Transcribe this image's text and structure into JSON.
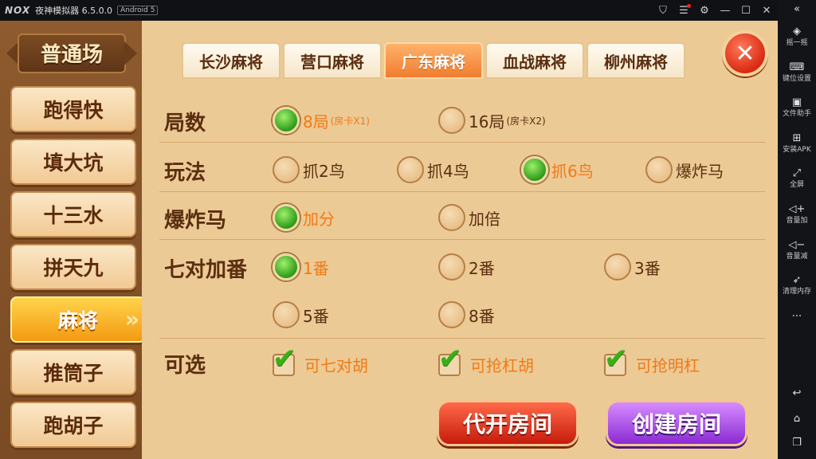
{
  "emulator": {
    "logo": "NOX",
    "app_name": "夜神模拟器 6.5.0.0",
    "android_badge": "Android 5",
    "controls": [
      "shirt-icon",
      "menu-icon",
      "gear-icon",
      "minimize-icon",
      "maximize-icon",
      "close-icon"
    ],
    "sidebar": [
      {
        "icon": "collapse-icon",
        "label": ""
      },
      {
        "icon": "shake-icon",
        "label": "摇一摇"
      },
      {
        "icon": "keyboard-icon",
        "label": "键位设置"
      },
      {
        "icon": "file-helper-icon",
        "label": "文件助手"
      },
      {
        "icon": "install-apk-icon",
        "label": "安装APK"
      },
      {
        "icon": "fullscreen-icon",
        "label": "全屏"
      },
      {
        "icon": "volume-up-icon",
        "label": "音量加"
      },
      {
        "icon": "volume-down-icon",
        "label": "音量减"
      },
      {
        "icon": "rocket-icon",
        "label": "清理内存"
      },
      {
        "icon": "more-icon",
        "label": ""
      },
      {
        "icon": "back-icon",
        "label": ""
      },
      {
        "icon": "home-icon",
        "label": ""
      },
      {
        "icon": "recent-apps-icon",
        "label": ""
      }
    ]
  },
  "game": {
    "title": "普通场",
    "categories": [
      "跑得快",
      "填大坑",
      "十三水",
      "拼天九",
      "麻将",
      "推筒子",
      "跑胡子"
    ],
    "active_category": "麻将",
    "tabs": [
      "长沙麻将",
      "营口麻将",
      "广东麻将",
      "血战麻将",
      "柳州麻将"
    ],
    "active_tab": "广东麻将",
    "rows": {
      "rounds": {
        "label": "局数",
        "options": [
          {
            "text": "8局",
            "note": "(房卡X1)",
            "selected": true
          },
          {
            "text": "16局",
            "note": "(房卡X2)",
            "selected": false
          }
        ]
      },
      "play": {
        "label": "玩法",
        "options": [
          {
            "text": "抓2鸟",
            "selected": false
          },
          {
            "text": "抓4鸟",
            "selected": false
          },
          {
            "text": "抓6鸟",
            "selected": true
          },
          {
            "text": "爆炸马",
            "selected": false
          }
        ]
      },
      "bomb_horse": {
        "label": "爆炸马",
        "options": [
          {
            "text": "加分",
            "selected": true
          },
          {
            "text": "加倍",
            "selected": false
          }
        ]
      },
      "seven_pairs": {
        "label": "七对加番",
        "options": [
          {
            "text": "1番",
            "selected": true
          },
          {
            "text": "2番",
            "selected": false
          },
          {
            "text": "3番",
            "selected": false
          },
          {
            "text": "5番",
            "selected": false
          },
          {
            "text": "8番",
            "selected": false
          }
        ]
      },
      "optional": {
        "label": "可选",
        "options": [
          {
            "text": "可七对胡",
            "checked": true
          },
          {
            "text": "可抢杠胡",
            "checked": true
          },
          {
            "text": "可抢明杠",
            "checked": true
          }
        ]
      }
    },
    "buttons": {
      "proxy_open": "代开房间",
      "create_room": "创建房间",
      "close": "✕"
    }
  }
}
